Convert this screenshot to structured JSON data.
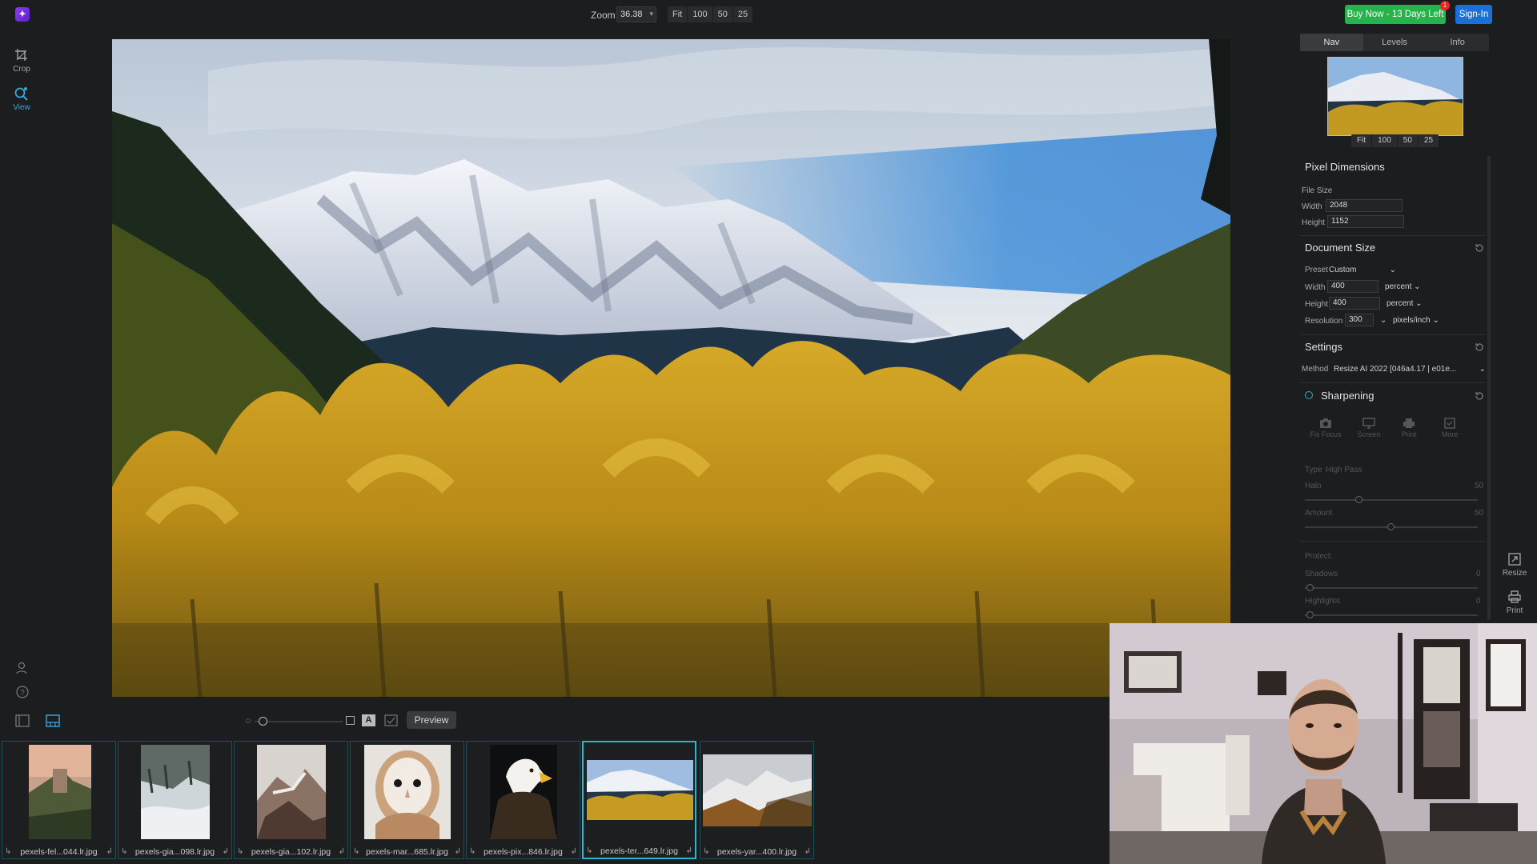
{
  "topbar": {
    "zoom_label": "Zoom",
    "zoom_value": "36.38",
    "zoom_buttons": [
      "Fit",
      "100",
      "50",
      "25"
    ],
    "buy_label": "Buy Now - 13 Days Left",
    "notification_count": "1",
    "signin_label": "Sign-In"
  },
  "left_tools": [
    {
      "label": "Crop",
      "icon": "crop-icon"
    },
    {
      "label": "View",
      "icon": "view-icon",
      "active": true
    }
  ],
  "right_panel": {
    "tabs": [
      "Nav",
      "Levels",
      "Info"
    ],
    "nav_zoom_buttons": [
      "Fit",
      "100",
      "50",
      "25"
    ],
    "pixel_dimensions": {
      "title": "Pixel Dimensions",
      "file_size_label": "File Size",
      "width_label": "Width",
      "width_value": "2048",
      "height_label": "Height",
      "height_value": "1152"
    },
    "document_size": {
      "title": "Document Size",
      "preset_label": "Preset",
      "preset_value": "Custom",
      "width_label": "Width",
      "width_value": "400",
      "width_unit": "percent",
      "height_label": "Height",
      "height_value": "400",
      "height_unit": "percent",
      "resolution_label": "Resolution",
      "resolution_value": "300",
      "resolution_unit": "pixels/inch"
    },
    "settings": {
      "title": "Settings",
      "method_label": "Method",
      "method_value": "Resize AI 2022 [046a4.17 | e01e..."
    },
    "sharpening": {
      "title": "Sharpening",
      "presets": [
        "Fix Focus",
        "Screen",
        "Print",
        "More"
      ],
      "type_label": "Type",
      "type_value": "High Pass",
      "halo_label": "Halo",
      "halo_value": "50",
      "amount_label": "Amount",
      "amount_value": "50",
      "protect_label": "Protect:",
      "shadows_label": "Shadows",
      "shadows_value": "0",
      "highlights_label": "Highlights",
      "highlights_value": "0"
    }
  },
  "right_tools": [
    {
      "label": "Resize",
      "icon": "resize-icon"
    },
    {
      "label": "Print",
      "icon": "print-icon"
    }
  ],
  "bottom_toolbar": {
    "preview_label": "Preview"
  },
  "filmstrip": [
    {
      "name": "pexels-fel...044.lr.jpg",
      "selected": false
    },
    {
      "name": "pexels-gia...098.lr.jpg",
      "selected": false
    },
    {
      "name": "pexels-gia...102.lr.jpg",
      "selected": false
    },
    {
      "name": "pexels-mar...685.lr.jpg",
      "selected": false
    },
    {
      "name": "pexels-pix...846.lr.jpg",
      "selected": false
    },
    {
      "name": "pexels-ter...649.lr.jpg",
      "selected": true
    },
    {
      "name": "pexels-yar...400.lr.jpg",
      "selected": false
    }
  ]
}
